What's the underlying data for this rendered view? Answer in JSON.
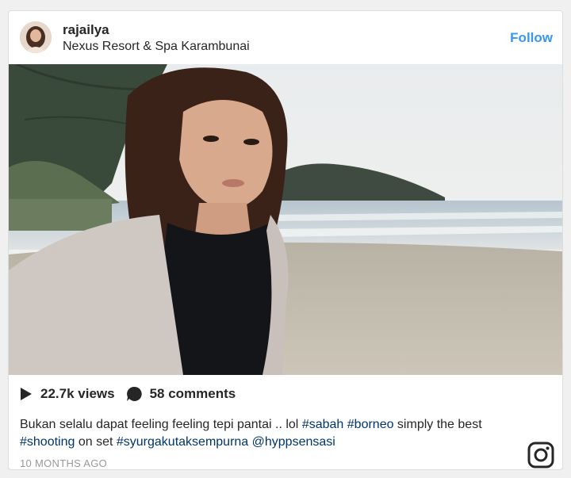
{
  "post": {
    "username": "rajailya",
    "location": "Nexus Resort & Spa Karambunai",
    "follow_label": "Follow",
    "views": "22.7k views",
    "comments": "58 comments",
    "caption": {
      "text_1": "Bukan selalu dapat feeling feeling tepi pantai .. lol ",
      "tag_1": "#sabah",
      "tag_2": "#borneo",
      "text_2": " simply the best ",
      "tag_3": "#shooting",
      "text_3": " on set ",
      "tag_4": "#syurgakutaksempurna",
      "mention": "@hyppsensasi"
    },
    "timestamp": "10 MONTHS AGO"
  },
  "icons": {
    "play": "play-icon",
    "comment": "comment-bubble-icon",
    "instagram": "instagram-logo-icon"
  },
  "colors": {
    "follow": "#3897f0",
    "hashtag": "#003569",
    "text": "#262626",
    "muted": "#999999"
  }
}
